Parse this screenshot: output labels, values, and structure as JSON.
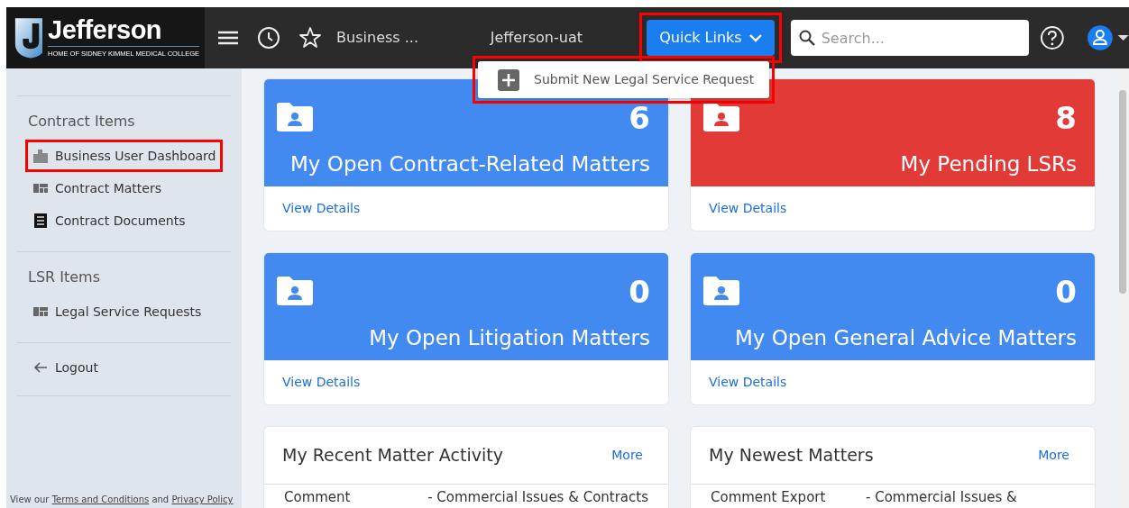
{
  "topbar": {
    "logo": {
      "name": "Jefferson",
      "tagline": "HOME OF SIDNEY KIMMEL MEDICAL COLLEGE"
    },
    "breadcrumb": "Business ...",
    "environment": "Jefferson-uat",
    "quick_links": {
      "label": "Quick Links",
      "expanded": true,
      "highlighted": true,
      "items": [
        {
          "label": "Submit New Legal Service Request",
          "highlighted": true
        }
      ]
    },
    "search": {
      "placeholder": "Search..."
    }
  },
  "sidebar": {
    "sections": [
      {
        "title": "Contract Items",
        "items": [
          {
            "label": "Business User Dashboard",
            "highlighted": true
          },
          {
            "label": "Contract Matters",
            "highlighted": false
          },
          {
            "label": "Contract Documents",
            "highlighted": false
          }
        ]
      },
      {
        "title": "LSR Items",
        "items": [
          {
            "label": "Legal Service Requests",
            "highlighted": false
          }
        ]
      }
    ],
    "logout": "Logout",
    "footer": {
      "prefix": "View our",
      "links": [
        "Terms and Conditions",
        "Privacy Policy"
      ],
      "joiner": "and"
    }
  },
  "tiles": [
    {
      "count": "6",
      "title": "My Open Contract-Related Matters",
      "link": "View Details",
      "color": "#4289f0"
    },
    {
      "count": "8",
      "title": "My Pending LSRs",
      "link": "View Details",
      "color": "#e23a37"
    },
    {
      "count": "0",
      "title": "My Open Litigation Matters",
      "link": "View Details",
      "color": "#4289f0"
    },
    {
      "count": "0",
      "title": "My Open General Advice Matters",
      "link": "View Details",
      "color": "#4289f0"
    }
  ],
  "panels": [
    {
      "title": "My Recent Matter Activity",
      "more": "More",
      "rows": [
        [
          "Comment",
          "- Commercial Issues & Contracts"
        ]
      ]
    },
    {
      "title": "My Newest Matters",
      "more": "More",
      "rows": [
        [
          "Comment Export",
          "- Commercial Issues &"
        ]
      ]
    }
  ]
}
